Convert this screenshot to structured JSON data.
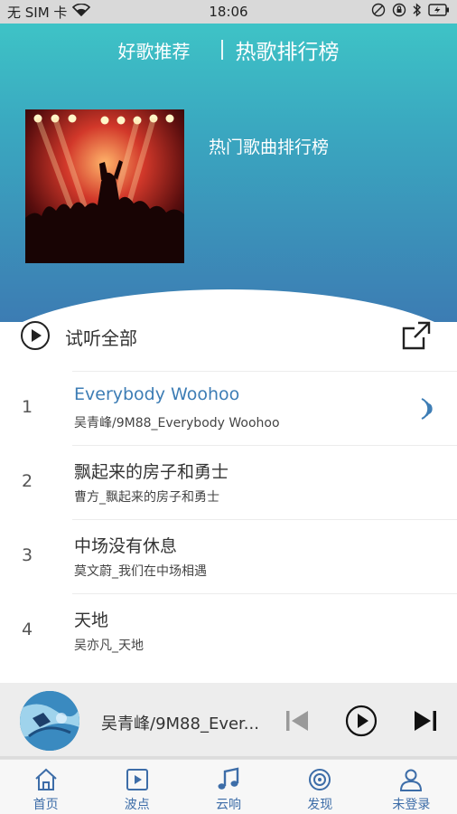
{
  "status_bar": {
    "carrier": "无 SIM 卡",
    "time": "18:06"
  },
  "header": {
    "tabs": [
      {
        "label": "好歌推荐"
      },
      {
        "label": "热歌排行榜"
      }
    ],
    "playlist_title": "热门歌曲排行榜"
  },
  "play_all": {
    "label": "试听全部"
  },
  "songs": [
    {
      "rank": "1",
      "title": "Everybody Woohoo",
      "subtitle": "吴青峰/9M88_Everybody Woohoo",
      "playing": true
    },
    {
      "rank": "2",
      "title": "飘起来的房子和勇士",
      "subtitle": "曹方_飘起来的房子和勇士",
      "playing": false
    },
    {
      "rank": "3",
      "title": "中场没有休息",
      "subtitle": "莫文蔚_我们在中场相遇",
      "playing": false
    },
    {
      "rank": "4",
      "title": "天地",
      "subtitle": "吴亦凡_天地",
      "playing": false
    }
  ],
  "player": {
    "now_playing": "吴青峰/9M88_Ever..."
  },
  "nav": [
    {
      "label": "首页",
      "icon": "home-icon"
    },
    {
      "label": "波点",
      "icon": "video-icon"
    },
    {
      "label": "云响",
      "icon": "music-note-icon"
    },
    {
      "label": "发现",
      "icon": "discover-icon"
    },
    {
      "label": "未登录",
      "icon": "user-icon"
    }
  ],
  "colors": {
    "accent": "#3d7db5",
    "header_top": "#3ec3c6",
    "header_bottom": "#3c7cb3",
    "nav_label": "#3d6da8"
  }
}
